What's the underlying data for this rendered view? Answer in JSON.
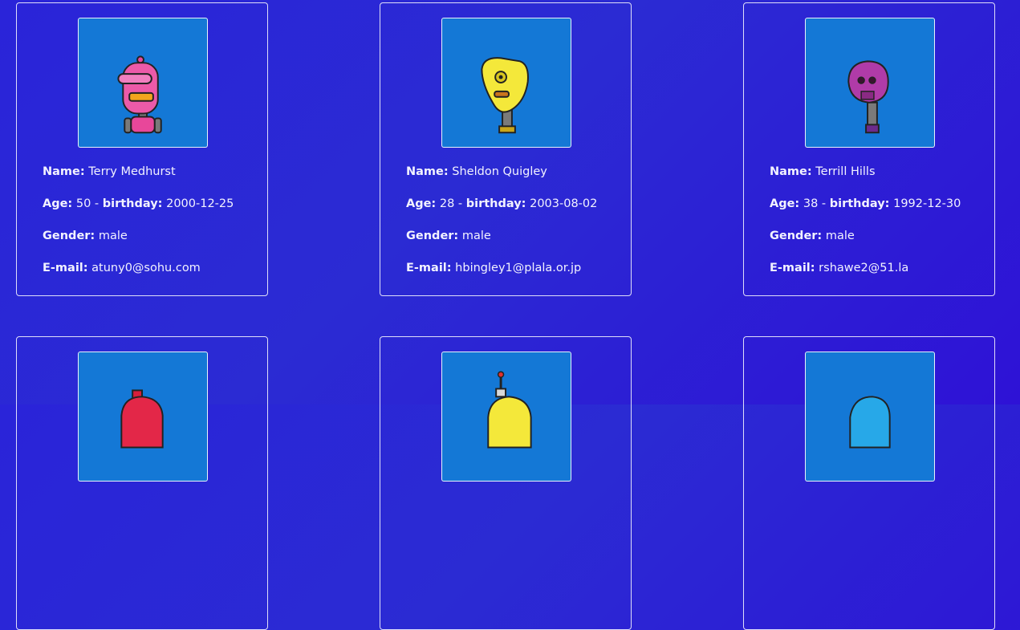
{
  "labels": {
    "name": "Name:",
    "age": "Age:",
    "birthday": "birthday:",
    "gender": "Gender:",
    "email": "E-mail:",
    "separator": " - "
  },
  "users": [
    {
      "name": "Terry Medhurst",
      "age": "50",
      "birthday": "2000-12-25",
      "gender": "male",
      "email": "atuny0@sohu.com",
      "avatar": "pink-robot"
    },
    {
      "name": "Sheldon Quigley",
      "age": "28",
      "birthday": "2003-08-02",
      "gender": "male",
      "email": "hbingley1@plala.or.jp",
      "avatar": "yellow-robot"
    },
    {
      "name": "Terrill Hills",
      "age": "38",
      "birthday": "1992-12-30",
      "gender": "male",
      "email": "rshawe2@51.la",
      "avatar": "purple-robot"
    },
    {
      "avatar": "red-robot"
    },
    {
      "avatar": "yellow-antenna-robot"
    },
    {
      "avatar": "blue-robot"
    }
  ],
  "colors": {
    "background": "#2a24d9",
    "avatar_background": "#1478d6",
    "text": "#f2f2ff"
  }
}
